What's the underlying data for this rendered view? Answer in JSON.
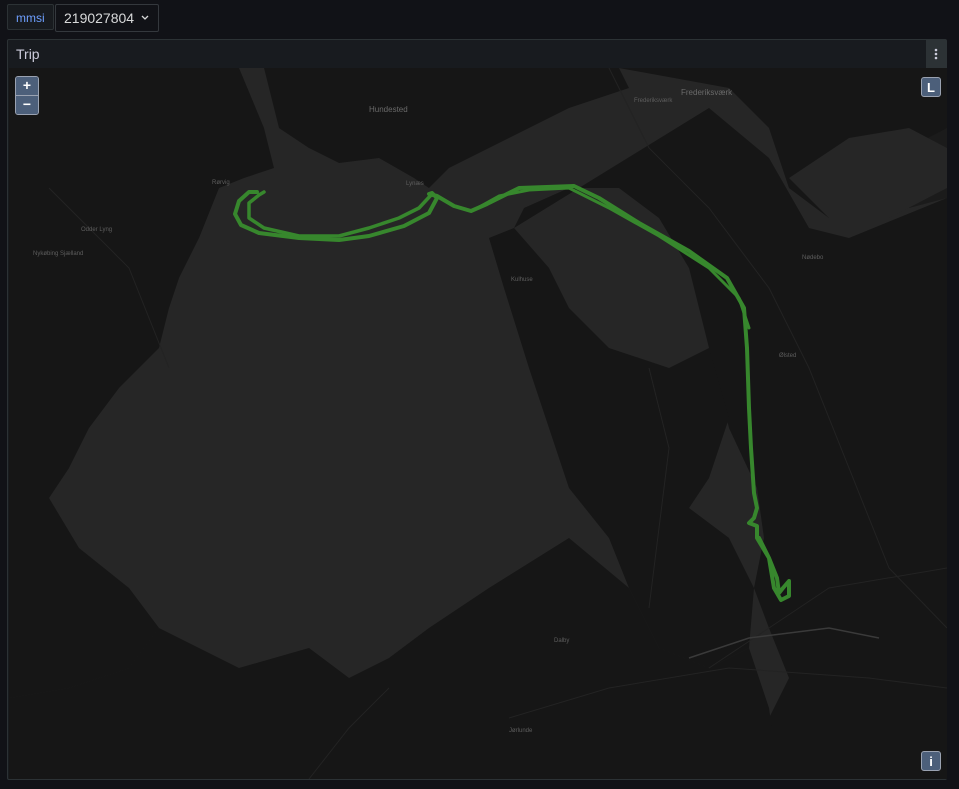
{
  "variables": {
    "label": "mmsi",
    "value": "219027804"
  },
  "panel": {
    "title": "Trip"
  },
  "map": {
    "controls": {
      "zoom_in": "+",
      "zoom_out": "−",
      "layer_button": "L",
      "info_button": "i"
    },
    "track_color": "#37872d",
    "water_color": "#262626",
    "land_color": "#161616",
    "places": [
      "Hundested",
      "Frederiksværk",
      "Rørvig",
      "Lynæs",
      "Frederiksværk",
      "Odder Lyng",
      "Nykøbing Sjælland",
      "Kulhuse",
      "Ølsted",
      "Nødebo",
      "Dalby",
      "Jørlunde"
    ]
  }
}
